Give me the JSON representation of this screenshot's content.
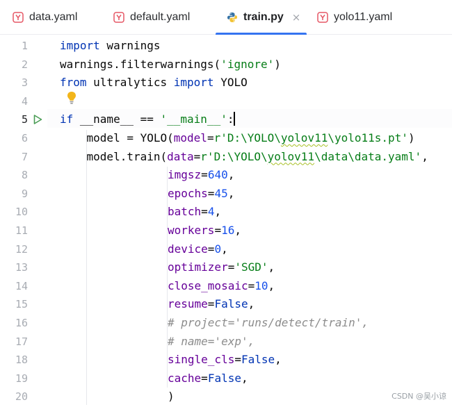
{
  "tabs": [
    {
      "label": "data.yaml",
      "icon": "yaml-file-icon",
      "active": false
    },
    {
      "label": "default.yaml",
      "icon": "yaml-file-icon",
      "active": false
    },
    {
      "label": "train.py",
      "icon": "python-file-icon",
      "active": true,
      "close": "×"
    },
    {
      "label": "yolo11.yaml",
      "icon": "yaml-file-icon",
      "active": false
    }
  ],
  "editor": {
    "line_numbers": [
      "1",
      "2",
      "3",
      "4",
      "5",
      "6",
      "7",
      "8",
      "9",
      "10",
      "11",
      "12",
      "13",
      "14",
      "15",
      "16",
      "17",
      "18",
      "19",
      "20"
    ],
    "current_line": 5,
    "colors": {
      "keyword": "#0033b3",
      "string": "#067d17",
      "number": "#1750eb",
      "param": "#660099",
      "comment": "#8c8c8c",
      "accent": "#3574f0"
    },
    "code": {
      "l1_kw": "import",
      "l1_rest": " warnings",
      "l2_a": "warnings.filterwarnings(",
      "l2_str": "'ignore'",
      "l2_b": ")",
      "l3_kw1": "from",
      "l3_mid": " ultralytics ",
      "l3_kw2": "import",
      "l3_rest": " YOLO",
      "l5_kw": "if",
      "l5_mid": " __name__ == ",
      "l5_str": "'__main__'",
      "l5_end": ":",
      "l6_a": "    model = YOLO(",
      "l6_param": "model",
      "l6_eq": "=",
      "l6_str_a": "r'D:\\YOLO\\",
      "l6_str_sq": "yolov11",
      "l6_str_b": "\\yolo11s.pt'",
      "l6_end": ")",
      "l7_a": "    model.train(",
      "l7_param": "data",
      "l7_eq": "=",
      "l7_str_a": "r'D:\\YOLO\\",
      "l7_str_sq": "yolov11",
      "l7_str_b": "\\data\\data.yaml'",
      "l7_end": ",",
      "l8_p": "imgsz",
      "l8_eq": "=",
      "l8_v": "640",
      "l8_end": ",",
      "l9_p": "epochs",
      "l9_eq": "=",
      "l9_v": "45",
      "l9_end": ",",
      "l10_p": "batch",
      "l10_eq": "=",
      "l10_v": "4",
      "l10_end": ",",
      "l11_p": "workers",
      "l11_eq": "=",
      "l11_v": "16",
      "l11_end": ",",
      "l12_p": "device",
      "l12_eq": "=",
      "l12_v": "0",
      "l12_end": ",",
      "l13_p": "optimizer",
      "l13_eq": "=",
      "l13_v": "'SGD'",
      "l13_end": ",",
      "l14_p": "close_mosaic",
      "l14_eq": "=",
      "l14_v": "10",
      "l14_end": ",",
      "l15_p": "resume",
      "l15_eq": "=",
      "l15_v": "False",
      "l15_end": ",",
      "l16_c": "# project='runs/detect/train',",
      "l17_c": "# name='exp',",
      "l18_p": "single_cls",
      "l18_eq": "=",
      "l18_v": "False",
      "l18_end": ",",
      "l19_p": "cache",
      "l19_eq": "=",
      "l19_v": "False",
      "l19_end": ",",
      "l20": ")"
    }
  },
  "watermark": "CSDN @吴小谅"
}
